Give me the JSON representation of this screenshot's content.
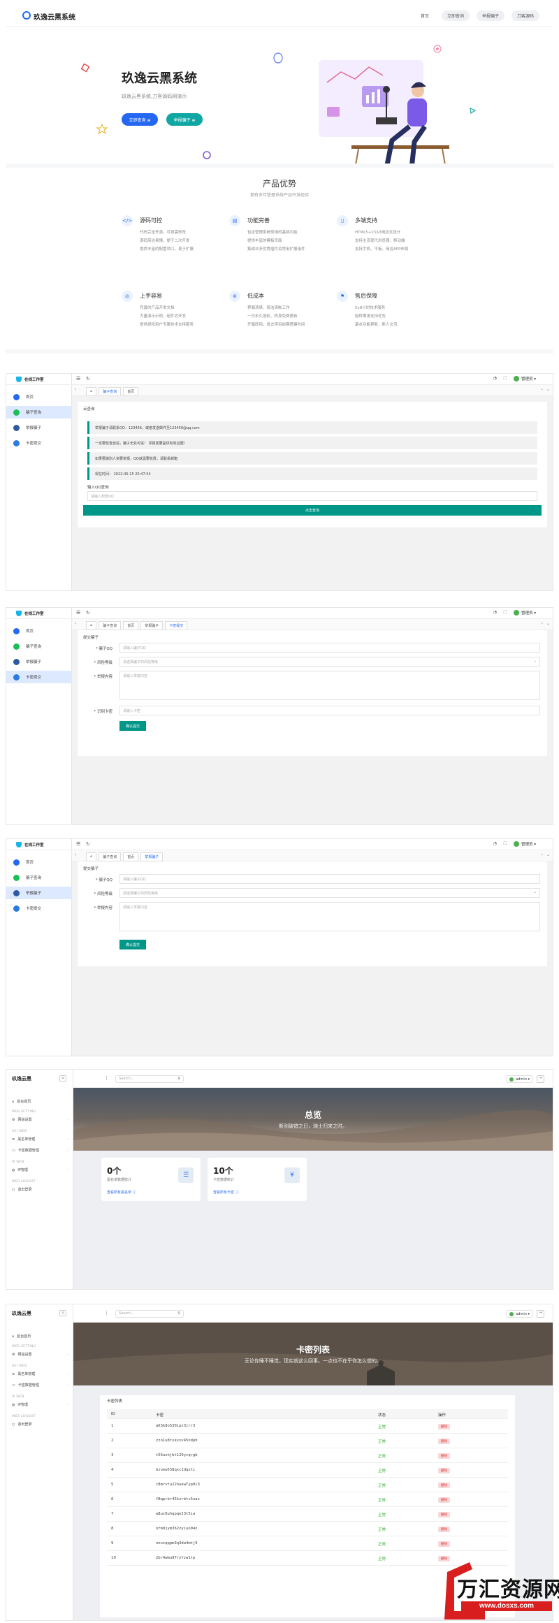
{
  "landing": {
    "logo": "玖逸云黑系统",
    "nav": [
      "首页",
      "立即查询",
      "举报骗子",
      "刀客源码"
    ],
    "hero_title": "玖逸云黑系统",
    "hero_sub": "玖逸云黑系统,刀客源码网演示",
    "btn_query": "立即查询 ⊕",
    "btn_report": "举报骗子 ⊕",
    "feat_title": "产品优势",
    "feat_sub": "拥有多年管理系统产品开发经验",
    "features": [
      {
        "icon": "</>",
        "name": "源码可控",
        "lines": [
          "代码完全开源，可按需修改",
          "源码简洁易懂，便于二次开发",
          "提供丰富的配置项口，易于扩展"
        ]
      },
      {
        "icon": "▤",
        "name": "功能完善",
        "lines": [
          "包含管理系统常用的基础功能",
          "提供丰富的模板页面",
          "集成众多优秀插件及常用扩展组件"
        ]
      },
      {
        "icon": "▯",
        "name": "多端支持",
        "lines": [
          "HTML5+CSS3响应式设计",
          "支持主流现代浏览器、移动端",
          "支持手机、平板、简洁APP布局"
        ]
      },
      {
        "icon": "◎",
        "name": "上手容易",
        "lines": [
          "完善的产品开发文档",
          "大量演示示例、组件式开发",
          "提供提权用户专属技术支持服务"
        ]
      },
      {
        "icon": "⊛",
        "name": "低成本",
        "lines": [
          "界面清爽、简洁清晰工作",
          "一次永久授权、终身免费更新",
          "开箱即用，省去项目前期搭建时间"
        ]
      },
      {
        "icon": "⚑",
        "name": "售后保障",
        "lines": [
          "5x8小时技术服务",
          "始终秉承支持优先",
          "基本功能更新、新人交流"
        ]
      }
    ]
  },
  "admin": {
    "brand": "在线工作室",
    "sidebar": [
      "首页",
      "骗子查询",
      "举报骗子",
      "卡密提交"
    ],
    "user": "管理员 ▾",
    "tabs1": [
      "骗子查询",
      "首页"
    ],
    "tabs2": [
      "骗子查询",
      "首页",
      "举报骗子",
      "卡密提交"
    ],
    "tabs3": [
      "骗子查询",
      "首页",
      "举报骗子"
    ],
    "s2": {
      "head": "云查询",
      "notices": [
        "举报骗子请联系QQ：123456，或者发送邮件至123456@qq.com",
        "一定要检查自信，骗子无处可逃！ 举报需要提供有效证据！",
        "如果要做别人资要举报，QQ就需要收费，请联系邮箱",
        "现在时间：  2022-06-15 20:47:54"
      ],
      "label": "输入QQ查询",
      "placeholder": "请输入想查QQ",
      "btn": "点击查询"
    },
    "form": {
      "head": "提交骗子",
      "qq_label": "* 骗子QQ",
      "qq_ph": "请输入骗子QQ",
      "risk_label": "* 风险等级",
      "risk_ph": "请选择骗子的风险等级",
      "content_label": "* 举报内容",
      "content_ph": "请输入举报内容",
      "card_label": "* 识别卡密",
      "card_ph": "请输入卡密",
      "submit": "确认提交"
    }
  },
  "dash": {
    "brand": "玖逸云黑",
    "sections": {
      "s0": "",
      "s1": "WEB SETTING",
      "s2": "HEI WEB",
      "s3": "IP WEB",
      "s4": "WEB LOGOUT"
    },
    "items": {
      "home": "后台首页",
      "site": "网站设置",
      "ban": "黑名单管理",
      "card": "卡密数据管理",
      "ip": "IP管理",
      "logout": "退出登录"
    },
    "search_ph": "Search...",
    "admin": "admin ▾",
    "overview": {
      "title": "总览",
      "sub": "斯剑破错之日，骑士归来之时。",
      "stat1_n": "0个",
      "stat1_l": "黑名单数据统计",
      "stat1_link": "查看所有黑名单 ⓘ",
      "stat2_n": "10个",
      "stat2_l": "卡密数据统计",
      "stat2_link": "查看所有卡密 ⓘ"
    },
    "cards": {
      "title": "卡密列表",
      "sub": "无论你睡不睡觉，现实就这么回事。一点也不在乎你怎么想的。",
      "table_title": "卡密列表",
      "headers": [
        "ID",
        "卡密",
        "状态",
        "操作"
      ],
      "status": "正常",
      "op": "删除",
      "rows": [
        {
          "id": "1",
          "key": "a63k8o530ipz3jrr3"
        },
        {
          "id": "2",
          "key": "zzo1u8txkxxv45ndph"
        },
        {
          "id": "3",
          "key": "t56uzhjbt129ycqrgb"
        },
        {
          "id": "4",
          "key": "bzoew558qxc1dqxti"
        },
        {
          "id": "5",
          "key": "c8mrvtu22huewTyp0i3"
        },
        {
          "id": "6",
          "key": "fBqprbr45kxrbtc5oas"
        },
        {
          "id": "7",
          "key": "w8uc0uhqpqeJ3t5ia"
        },
        {
          "id": "8",
          "key": "nfm9jym362zyiuo04z"
        },
        {
          "id": "9",
          "key": "onovqqpm3q3dw4mtj9"
        },
        {
          "id": "10",
          "key": "2br4wmu97ryfzw1tp"
        }
      ]
    }
  },
  "watermark": {
    "brand": "万汇资源网",
    "url": "www.dosxs.com"
  }
}
